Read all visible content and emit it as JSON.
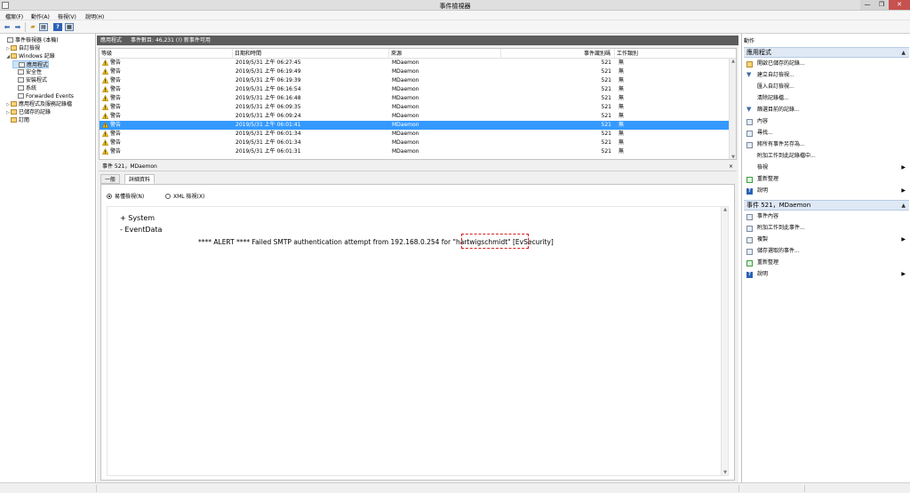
{
  "window": {
    "title": "事件檢視器",
    "min": "—",
    "max": "❐",
    "close": "✕"
  },
  "menu": [
    "檔案(F)",
    "動作(A)",
    "檢視(V)",
    "說明(H)"
  ],
  "tree": [
    {
      "label": "事件檢視器 (本機)",
      "twisty": "",
      "icon": "computer"
    },
    {
      "label": "自訂檢視",
      "twisty": "▷",
      "icon": "folder"
    },
    {
      "label": "Windows 記錄",
      "twisty": "◢",
      "icon": "folder"
    },
    {
      "label": "應用程式",
      "twisty": "",
      "icon": "log",
      "selected": true
    },
    {
      "label": "安全性",
      "twisty": "",
      "icon": "log"
    },
    {
      "label": "安裝程式",
      "twisty": "",
      "icon": "log"
    },
    {
      "label": "系統",
      "twisty": "",
      "icon": "log"
    },
    {
      "label": "Forwarded Events",
      "twisty": "",
      "icon": "log"
    },
    {
      "label": "應用程式及服務記錄檔",
      "twisty": "▷",
      "icon": "folder"
    },
    {
      "label": "已儲存的記錄",
      "twisty": "▷",
      "icon": "folder"
    },
    {
      "label": "訂閱",
      "twisty": "",
      "icon": "folder"
    }
  ],
  "center": {
    "log_name": "應用程式",
    "event_count": "事件數目: 46,231 (!) 新事件可用",
    "columns": [
      "等級",
      "日期和時間",
      "來源",
      "事件識別碼",
      "工作類別"
    ],
    "rows": [
      {
        "level": "警告",
        "datetime": "2019/5/31 上午 06:27:45",
        "source": "MDaemon",
        "id": "521",
        "category": "無"
      },
      {
        "level": "警告",
        "datetime": "2019/5/31 上午 06:19:49",
        "source": "MDaemon",
        "id": "521",
        "category": "無"
      },
      {
        "level": "警告",
        "datetime": "2019/5/31 上午 06:19:39",
        "source": "MDaemon",
        "id": "521",
        "category": "無"
      },
      {
        "level": "警告",
        "datetime": "2019/5/31 上午 06:16:54",
        "source": "MDaemon",
        "id": "521",
        "category": "無"
      },
      {
        "level": "警告",
        "datetime": "2019/5/31 上午 06:16:48",
        "source": "MDaemon",
        "id": "521",
        "category": "無"
      },
      {
        "level": "警告",
        "datetime": "2019/5/31 上午 06:09:35",
        "source": "MDaemon",
        "id": "521",
        "category": "無"
      },
      {
        "level": "警告",
        "datetime": "2019/5/31 上午 06:09:24",
        "source": "MDaemon",
        "id": "521",
        "category": "無"
      },
      {
        "level": "警告",
        "datetime": "2019/5/31 上午 06:01:41",
        "source": "MDaemon",
        "id": "521",
        "category": "無",
        "selected": true
      },
      {
        "level": "警告",
        "datetime": "2019/5/31 上午 06:01:34",
        "source": "MDaemon",
        "id": "521",
        "category": "無"
      },
      {
        "level": "警告",
        "datetime": "2019/5/31 上午 06:01:34",
        "source": "MDaemon",
        "id": "521",
        "category": "無"
      },
      {
        "level": "警告",
        "datetime": "2019/5/31 上午 06:01:31",
        "source": "MDaemon",
        "id": "521",
        "category": "無"
      }
    ]
  },
  "detail": {
    "title": "事件 521，MDaemon",
    "close": "×",
    "tabs": [
      "一般",
      "詳細資料"
    ],
    "radio_friendly": "易懂檢視(N)",
    "radio_xml": "XML 檢視(X)",
    "node_system": "+  System",
    "node_eventdata": "-  EventData",
    "alert_text": "**** ALERT **** Failed SMTP authentication attempt from 192.168.0.254 for \"hartwigschmidt\" [EvSecurity]"
  },
  "actions": {
    "title": "動作",
    "section1": "應用程式",
    "items1": [
      {
        "label": "開啟已儲存的記錄...",
        "icon": "open"
      },
      {
        "label": "建立自訂檢視...",
        "icon": "filter"
      },
      {
        "label": "匯入自訂檢視...",
        "icon": "blank"
      },
      {
        "label": "清除記錄檔...",
        "icon": "blank"
      },
      {
        "label": "篩選目前的記錄...",
        "icon": "filter"
      },
      {
        "label": "內容",
        "icon": "props"
      },
      {
        "label": "尋找...",
        "icon": "find"
      },
      {
        "label": "將所有事件另存為...",
        "icon": "save"
      },
      {
        "label": "附加工作到此記錄檔中...",
        "icon": "blank"
      },
      {
        "label": "檢視",
        "icon": "blank",
        "sub": "▶"
      },
      {
        "label": "重新整理",
        "icon": "refresh"
      },
      {
        "label": "說明",
        "icon": "help",
        "sub": "▶"
      }
    ],
    "section2": "事件 521，MDaemon",
    "items2": [
      {
        "label": "事件內容",
        "icon": "props"
      },
      {
        "label": "附加工作到此事件...",
        "icon": "task"
      },
      {
        "label": "複製",
        "icon": "copy",
        "sub": "▶"
      },
      {
        "label": "儲存選取的事件...",
        "icon": "save"
      },
      {
        "label": "重新整理",
        "icon": "refresh"
      },
      {
        "label": "說明",
        "icon": "help",
        "sub": "▶"
      }
    ],
    "collapse": "▲"
  }
}
